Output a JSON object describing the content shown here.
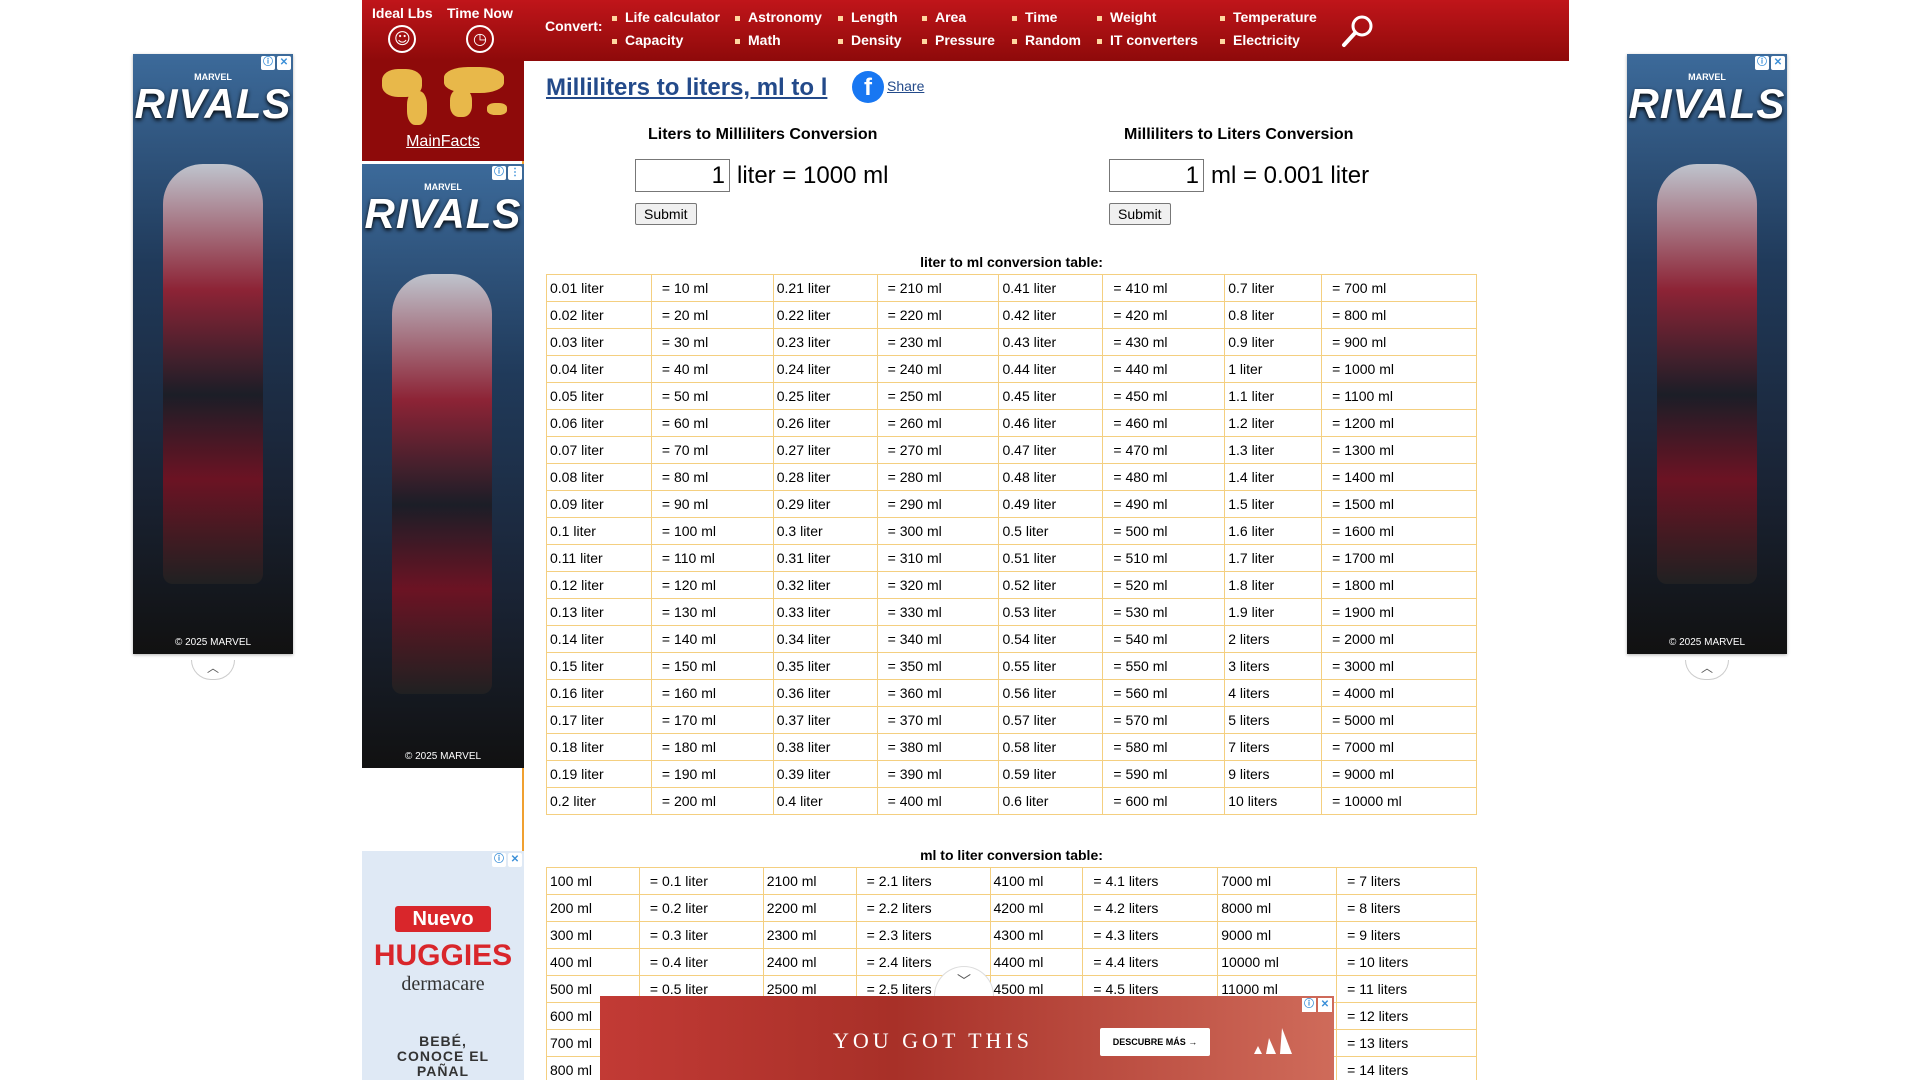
{
  "header": {
    "tools": [
      {
        "label": "Ideal Lbs",
        "icon": "smiley-icon"
      },
      {
        "label": "Time Now",
        "icon": "clock-icon"
      }
    ],
    "convert_label": "Convert:",
    "nav": [
      "Life calculator",
      "Capacity",
      "Astronomy",
      "Math",
      "Length",
      "Density",
      "Area",
      "Pressure",
      "Time",
      "Random",
      "Weight",
      "IT converters",
      "Temperature",
      "Electricity"
    ]
  },
  "sidebar": {
    "mainfacts": "MainFacts"
  },
  "page": {
    "title": "Milliliters to liters, ml to l",
    "share": "Share"
  },
  "converters": [
    {
      "title": "Liters to Milliliters Conversion",
      "value": "1",
      "result": "liter = 1000 ml",
      "submit": "Submit"
    },
    {
      "title": "Milliliters to Liters Conversion",
      "value": "1",
      "result": "ml = 0.001 liter",
      "submit": "Submit"
    }
  ],
  "table1": {
    "title": "liter to ml conversion table:",
    "rows": [
      [
        "0.01 liter",
        "= 10 ml",
        "0.21 liter",
        "= 210 ml",
        "0.41 liter",
        "= 410 ml",
        "0.7 liter",
        "= 700 ml"
      ],
      [
        "0.02 liter",
        "= 20 ml",
        "0.22 liter",
        "= 220 ml",
        "0.42 liter",
        "= 420 ml",
        "0.8 liter",
        "= 800 ml"
      ],
      [
        "0.03 liter",
        "= 30 ml",
        "0.23 liter",
        "= 230 ml",
        "0.43 liter",
        "= 430 ml",
        "0.9 liter",
        "= 900 ml"
      ],
      [
        "0.04 liter",
        "= 40 ml",
        "0.24 liter",
        "= 240 ml",
        "0.44 liter",
        "= 440 ml",
        "1 liter",
        "= 1000 ml"
      ],
      [
        "0.05 liter",
        "= 50 ml",
        "0.25 liter",
        "= 250 ml",
        "0.45 liter",
        "= 450 ml",
        "1.1 liter",
        "= 1100 ml"
      ],
      [
        "0.06 liter",
        "= 60 ml",
        "0.26 liter",
        "= 260 ml",
        "0.46 liter",
        "= 460 ml",
        "1.2 liter",
        "= 1200 ml"
      ],
      [
        "0.07 liter",
        "= 70 ml",
        "0.27 liter",
        "= 270 ml",
        "0.47 liter",
        "= 470 ml",
        "1.3 liter",
        "= 1300 ml"
      ],
      [
        "0.08 liter",
        "= 80 ml",
        "0.28 liter",
        "= 280 ml",
        "0.48 liter",
        "= 480 ml",
        "1.4 liter",
        "= 1400 ml"
      ],
      [
        "0.09 liter",
        "= 90 ml",
        "0.29 liter",
        "= 290 ml",
        "0.49 liter",
        "= 490 ml",
        "1.5 liter",
        "= 1500 ml"
      ],
      [
        "0.1 liter",
        "= 100 ml",
        "0.3 liter",
        "= 300 ml",
        "0.5 liter",
        "= 500 ml",
        "1.6 liter",
        "= 1600 ml"
      ],
      [
        "0.11 liter",
        "= 110 ml",
        "0.31 liter",
        "= 310 ml",
        "0.51 liter",
        "= 510 ml",
        "1.7 liter",
        "= 1700 ml"
      ],
      [
        "0.12 liter",
        "= 120 ml",
        "0.32 liter",
        "= 320 ml",
        "0.52 liter",
        "= 520 ml",
        "1.8 liter",
        "= 1800 ml"
      ],
      [
        "0.13 liter",
        "= 130 ml",
        "0.33 liter",
        "= 330 ml",
        "0.53 liter",
        "= 530 ml",
        "1.9 liter",
        "= 1900 ml"
      ],
      [
        "0.14 liter",
        "= 140 ml",
        "0.34 liter",
        "= 340 ml",
        "0.54 liter",
        "= 540 ml",
        "2 liters",
        "= 2000 ml"
      ],
      [
        "0.15 liter",
        "= 150 ml",
        "0.35 liter",
        "= 350 ml",
        "0.55 liter",
        "= 550 ml",
        "3 liters",
        "= 3000 ml"
      ],
      [
        "0.16 liter",
        "= 160 ml",
        "0.36 liter",
        "= 360 ml",
        "0.56 liter",
        "= 560 ml",
        "4 liters",
        "= 4000 ml"
      ],
      [
        "0.17 liter",
        "= 170 ml",
        "0.37 liter",
        "= 370 ml",
        "0.57 liter",
        "= 570 ml",
        "5 liters",
        "= 5000 ml"
      ],
      [
        "0.18 liter",
        "= 180 ml",
        "0.38 liter",
        "= 380 ml",
        "0.58 liter",
        "= 580 ml",
        "7 liters",
        "= 7000 ml"
      ],
      [
        "0.19 liter",
        "= 190 ml",
        "0.39 liter",
        "= 390 ml",
        "0.59 liter",
        "= 590 ml",
        "9 liters",
        "= 9000 ml"
      ],
      [
        "0.2 liter",
        "= 200 ml",
        "0.4 liter",
        "= 400 ml",
        "0.6 liter",
        "= 600 ml",
        "10 liters",
        "= 10000 ml"
      ]
    ]
  },
  "table2": {
    "title": "ml to liter conversion table:",
    "rows": [
      [
        "100 ml",
        "= 0.1 liter",
        "2100 ml",
        "= 2.1 liters",
        "4100 ml",
        "= 4.1 liters",
        "7000 ml",
        "= 7 liters"
      ],
      [
        "200 ml",
        "= 0.2 liter",
        "2200 ml",
        "= 2.2 liters",
        "4200 ml",
        "= 4.2 liters",
        "8000 ml",
        "= 8 liters"
      ],
      [
        "300 ml",
        "= 0.3 liter",
        "2300 ml",
        "= 2.3 liters",
        "4300 ml",
        "= 4.3 liters",
        "9000 ml",
        "= 9 liters"
      ],
      [
        "400 ml",
        "= 0.4 liter",
        "2400 ml",
        "= 2.4 liters",
        "4400 ml",
        "= 4.4 liters",
        "10000 ml",
        "= 10 liters"
      ],
      [
        "500 ml",
        "= 0.5 liter",
        "2500 ml",
        "= 2.5 liters",
        "4500 ml",
        "= 4.5 liters",
        "11000 ml",
        "= 11 liters"
      ],
      [
        "600 ml",
        "",
        "",
        "",
        "",
        "",
        "",
        "= 12 liters"
      ],
      [
        "700 ml",
        "",
        "",
        "",
        "",
        "",
        "",
        "= 13 liters"
      ],
      [
        "800 ml",
        "",
        "",
        "",
        "",
        "",
        "",
        "= 14 liters"
      ]
    ]
  },
  "ads": {
    "side_brand": "RIVALS",
    "side_sub": "MARVEL",
    "side_copy": "© 2025 MARVEL",
    "huggies_nuevo": "Nuevo",
    "huggies_brand": "HUGGIES",
    "huggies_sub": "dermacare",
    "huggies_tagline": "BEBÉ, CONOCE EL PAÑAL",
    "bottom_text": "YOU GOT THIS",
    "bottom_button": "DESCUBRE MÁS →",
    "ad_info_icon": "ⓘ",
    "ad_close_icon": "✕"
  },
  "colors": {
    "header": "#a80f14",
    "table_border": "#f4cf80",
    "link": "#234a8a",
    "accent_orange": "#f0a030"
  }
}
